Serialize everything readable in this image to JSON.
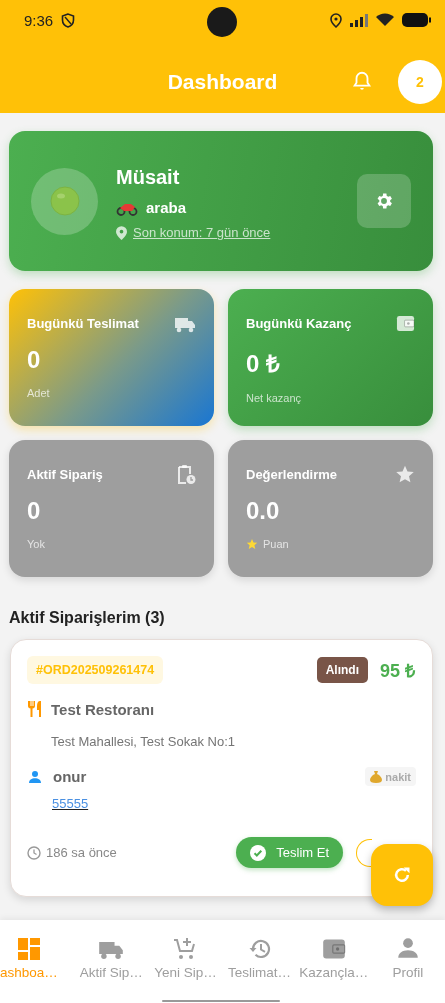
{
  "status_bar": {
    "time": "9:36"
  },
  "app_bar": {
    "title": "Dashboard",
    "avatar": "2"
  },
  "status_card": {
    "status": "Müsait",
    "vehicle": "araba",
    "location": "Son konum: 7 gün önce"
  },
  "stats": [
    {
      "kind": "deliveries",
      "title": "Bugünkü Teslimat",
      "value": "0",
      "caption": "Adet"
    },
    {
      "kind": "earnings",
      "title": "Bugünkü Kazanç",
      "value": "0 ₺",
      "caption": "Net kazanç"
    },
    {
      "kind": "active",
      "title": "Aktif Sipariş",
      "value": "0",
      "caption": "Yok"
    },
    {
      "kind": "rating",
      "title": "Değerlendirme",
      "value": "0.0",
      "caption": "Puan"
    }
  ],
  "section_title": "Aktif Siparişlerim (3)",
  "orders": [
    {
      "code": "#ORD202509261474",
      "status": "Alındı",
      "price": "95 ₺",
      "restaurant": "Test Restoranı",
      "address": "Test Mahallesi, Test Sokak No:1",
      "customer": "onur",
      "payment": "nakit",
      "phone": "55555",
      "time": "186 sa önce",
      "action": "Teslim Et"
    }
  ],
  "nav": [
    {
      "kind": "dashboard",
      "label": "ashboa…",
      "selected": true
    },
    {
      "kind": "active",
      "label": "Aktif Sip…",
      "selected": false
    },
    {
      "kind": "new",
      "label": "Yeni Sip…",
      "selected": false
    },
    {
      "kind": "deliveries",
      "label": "Teslimat…",
      "selected": false
    },
    {
      "kind": "earnings",
      "label": "Kazançla…",
      "selected": false
    },
    {
      "kind": "profile",
      "label": "Profil",
      "selected": false
    }
  ]
}
